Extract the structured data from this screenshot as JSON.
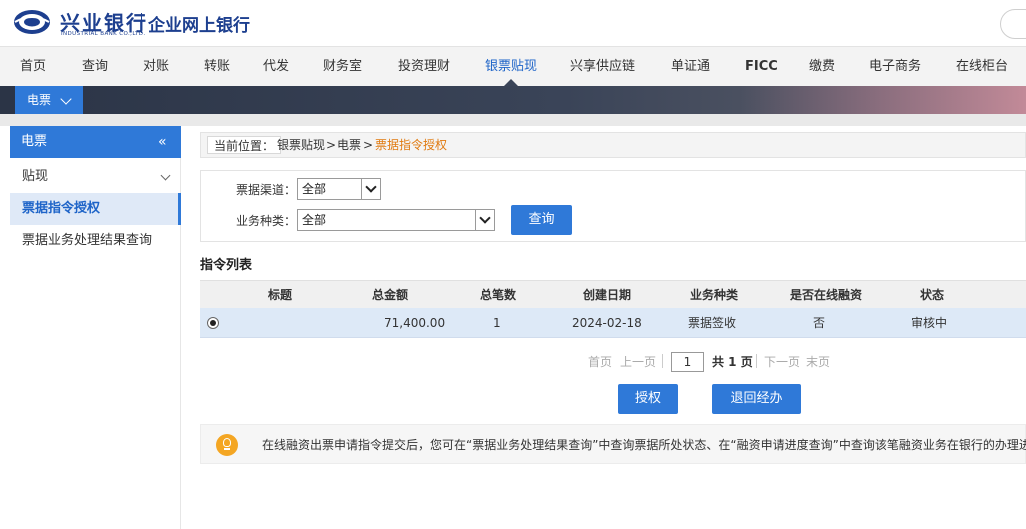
{
  "header": {
    "bank_name": "兴业银行",
    "bank_name_en": "INDUSTRIAL BANK CO.,LTD.",
    "portal_name": "企业网上银行"
  },
  "nav": {
    "items": [
      {
        "label": "首页"
      },
      {
        "label": "查询"
      },
      {
        "label": "对账"
      },
      {
        "label": "转账"
      },
      {
        "label": "代发"
      },
      {
        "label": "财务室"
      },
      {
        "label": "投资理财"
      },
      {
        "label": "银票贴现"
      },
      {
        "label": "兴享供应链"
      },
      {
        "label": "单证通"
      },
      {
        "label": "FICC"
      },
      {
        "label": "缴费"
      },
      {
        "label": "电子商务"
      },
      {
        "label": "在线柜台"
      }
    ],
    "active": "银票贴现",
    "sub_menu": "电票"
  },
  "sidebar": {
    "title": "电票",
    "collapse_glyph": "«",
    "items": [
      {
        "label": "贴现"
      },
      {
        "label": "票据指令授权"
      },
      {
        "label": "票据业务处理结果查询"
      }
    ]
  },
  "breadcrumb": {
    "label": "当前位置：",
    "path1": "银票贴现",
    "sep": ">",
    "path2": "电票",
    "current": "票据指令授权"
  },
  "filters": {
    "channel_label": "票据渠道：",
    "channel_value": "全部",
    "type_label": "业务种类：",
    "type_value": "全部",
    "query_button": "查询"
  },
  "list": {
    "title": "指令列表",
    "columns": [
      "标题",
      "总金额",
      "总笔数",
      "创建日期",
      "业务种类",
      "是否在线融资",
      "状态"
    ],
    "rows": [
      {
        "title": "",
        "amount": "71,400.00",
        "count": "1",
        "date": "2024-02-18",
        "type": "票据签收",
        "online_financing": "否",
        "status": "审核中"
      }
    ]
  },
  "pager": {
    "first": "首页",
    "prev": "上一页",
    "page": "1",
    "total": "共 1 页",
    "next": "下一页",
    "last": "末页"
  },
  "actions": {
    "authorize": "授权",
    "return": "退回经办"
  },
  "notice": {
    "text": "在线融资出票申请指令提交后，您可在“票据业务处理结果查询”中查询票据所处状态、在“融资申请进度查询”中查询该笔融资业务在银行的办理进度。"
  },
  "colors": {
    "primary": "#2f79d8",
    "brand": "#1d3f8f",
    "highlight": "#e07a10",
    "row_selected": "#dde9f7"
  }
}
